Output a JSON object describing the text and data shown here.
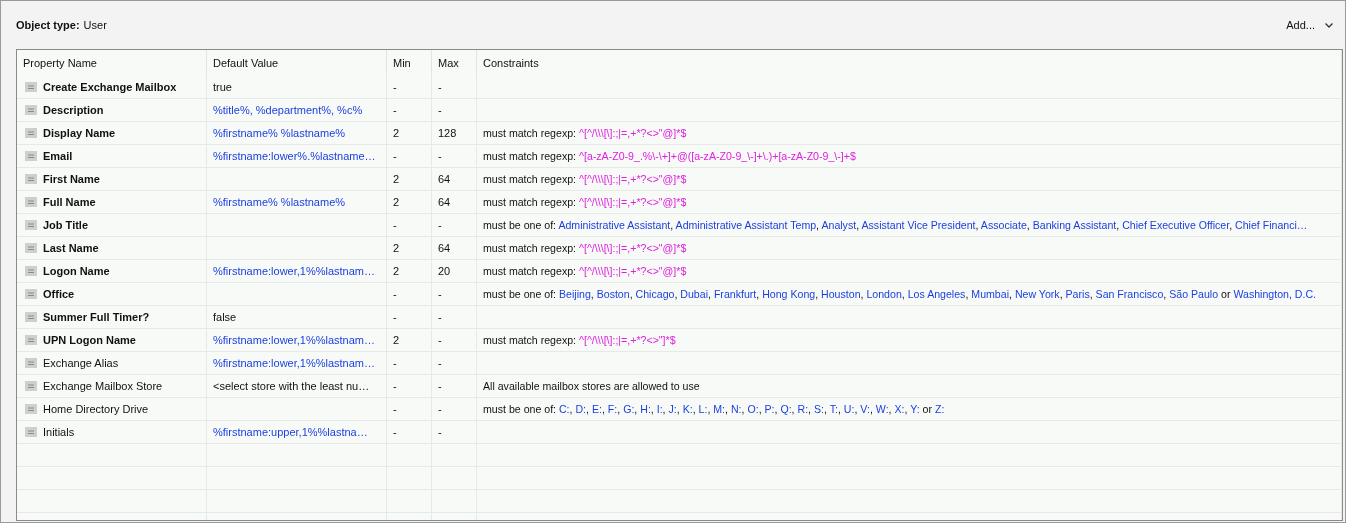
{
  "header": {
    "label": "Object type:",
    "value": "User",
    "add_button": "Add..."
  },
  "table": {
    "columns": [
      "Property Name",
      "Default Value",
      "Min",
      "Max",
      "Constraints"
    ],
    "rows": [
      {
        "name": "Create Exchange Mailbox",
        "required": true,
        "default": {
          "text": "true",
          "kind": "literal"
        },
        "min": "-",
        "max": "-"
      },
      {
        "name": "Description",
        "required": true,
        "default": {
          "text": "%title%, %department%, %c%",
          "kind": "template"
        },
        "min": "-",
        "max": "-"
      },
      {
        "name": "Display Name",
        "required": true,
        "default": {
          "text": "%firstname% %lastname%",
          "kind": "template"
        },
        "min": "2",
        "max": "128",
        "constraint": [
          {
            "text": "must match regexp: ",
            "kind": "label"
          },
          {
            "text": "^[^/\\\\\\[\\]:;|=,+*?<>\"@]*$",
            "kind": "regexp"
          }
        ]
      },
      {
        "name": "Email",
        "required": true,
        "default": {
          "text": "%firstname:lower%.%lastname…",
          "kind": "template"
        },
        "min": "-",
        "max": "-",
        "constraint": [
          {
            "text": "must match regexp: ",
            "kind": "label"
          },
          {
            "text": "^[a-zA-Z0-9_.%\\-\\+]+@([a-zA-Z0-9_\\-]+\\.)+[a-zA-Z0-9_\\-]+$",
            "kind": "regexp"
          }
        ]
      },
      {
        "name": "First Name",
        "required": true,
        "min": "2",
        "max": "64",
        "constraint": [
          {
            "text": "must match regexp: ",
            "kind": "label"
          },
          {
            "text": "^[^/\\\\\\[\\]:;|=,+*?<>\"@]*$",
            "kind": "regexp"
          }
        ]
      },
      {
        "name": "Full Name",
        "required": true,
        "default": {
          "text": "%firstname% %lastname%",
          "kind": "template"
        },
        "min": "2",
        "max": "64",
        "constraint": [
          {
            "text": "must match regexp: ",
            "kind": "label"
          },
          {
            "text": "^[^/\\\\\\[\\]:;|=,+*?<>\"@]*$",
            "kind": "regexp"
          }
        ]
      },
      {
        "name": "Job Title",
        "required": true,
        "min": "-",
        "max": "-",
        "constraint": [
          {
            "text": "must be one of: ",
            "kind": "label"
          },
          {
            "text": "Administrative Assistant",
            "kind": "value"
          },
          {
            "text": ", ",
            "kind": "label"
          },
          {
            "text": "Administrative Assistant Temp",
            "kind": "value"
          },
          {
            "text": ", ",
            "kind": "label"
          },
          {
            "text": "Analyst",
            "kind": "value"
          },
          {
            "text": ", ",
            "kind": "label"
          },
          {
            "text": "Assistant Vice President",
            "kind": "value"
          },
          {
            "text": ", ",
            "kind": "label"
          },
          {
            "text": "Associate",
            "kind": "value"
          },
          {
            "text": ", ",
            "kind": "label"
          },
          {
            "text": "Banking Assistant",
            "kind": "value"
          },
          {
            "text": ", ",
            "kind": "label"
          },
          {
            "text": "Chief Executive Officer",
            "kind": "value"
          },
          {
            "text": ", ",
            "kind": "label"
          },
          {
            "text": "Chief Financi…",
            "kind": "value"
          }
        ]
      },
      {
        "name": "Last Name",
        "required": true,
        "min": "2",
        "max": "64",
        "constraint": [
          {
            "text": "must match regexp: ",
            "kind": "label"
          },
          {
            "text": "^[^/\\\\\\[\\]:;|=,+*?<>\"@]*$",
            "kind": "regexp"
          }
        ]
      },
      {
        "name": "Logon Name",
        "required": true,
        "default": {
          "text": "%firstname:lower,1%%lastnam…",
          "kind": "template"
        },
        "min": "2",
        "max": "20",
        "constraint": [
          {
            "text": "must match regexp: ",
            "kind": "label"
          },
          {
            "text": "^[^/\\\\\\[\\]:;|=,+*?<>\"@]*$",
            "kind": "regexp"
          }
        ]
      },
      {
        "name": "Office",
        "required": true,
        "min": "-",
        "max": "-",
        "constraint": [
          {
            "text": "must be one of: ",
            "kind": "label"
          },
          {
            "text": "Beijing",
            "kind": "value"
          },
          {
            "text": ", ",
            "kind": "label"
          },
          {
            "text": "Boston",
            "kind": "value"
          },
          {
            "text": ", ",
            "kind": "label"
          },
          {
            "text": "Chicago",
            "kind": "value"
          },
          {
            "text": ", ",
            "kind": "label"
          },
          {
            "text": "Dubai",
            "kind": "value"
          },
          {
            "text": ", ",
            "kind": "label"
          },
          {
            "text": "Frankfurt",
            "kind": "value"
          },
          {
            "text": ", ",
            "kind": "label"
          },
          {
            "text": "Hong Kong",
            "kind": "value"
          },
          {
            "text": ", ",
            "kind": "label"
          },
          {
            "text": "Houston",
            "kind": "value"
          },
          {
            "text": ", ",
            "kind": "label"
          },
          {
            "text": "London",
            "kind": "value"
          },
          {
            "text": ", ",
            "kind": "label"
          },
          {
            "text": "Los Angeles",
            "kind": "value"
          },
          {
            "text": ", ",
            "kind": "label"
          },
          {
            "text": "Mumbai",
            "kind": "value"
          },
          {
            "text": ", ",
            "kind": "label"
          },
          {
            "text": "New York",
            "kind": "value"
          },
          {
            "text": ", ",
            "kind": "label"
          },
          {
            "text": "Paris",
            "kind": "value"
          },
          {
            "text": ", ",
            "kind": "label"
          },
          {
            "text": "San Francisco",
            "kind": "value"
          },
          {
            "text": ", ",
            "kind": "label"
          },
          {
            "text": "São Paulo",
            "kind": "value"
          },
          {
            "text": " or ",
            "kind": "label"
          },
          {
            "text": "Washington, D.C.",
            "kind": "value"
          }
        ]
      },
      {
        "name": "Summer Full Timer?",
        "required": true,
        "default": {
          "text": "false",
          "kind": "literal"
        },
        "min": "-",
        "max": "-"
      },
      {
        "name": "UPN Logon Name",
        "required": true,
        "default": {
          "text": "%firstname:lower,1%%lastnam…",
          "kind": "template"
        },
        "min": "2",
        "max": "-",
        "constraint": [
          {
            "text": "must match regexp: ",
            "kind": "label"
          },
          {
            "text": "^[^/\\\\\\[\\]:;|=,+*?<>\"]*$",
            "kind": "regexp"
          }
        ]
      },
      {
        "name": "Exchange Alias",
        "required": false,
        "default": {
          "text": "%firstname:lower,1%%lastnam…",
          "kind": "template"
        },
        "min": "-",
        "max": "-"
      },
      {
        "name": "Exchange Mailbox Store",
        "required": false,
        "default": {
          "text": "<select store with the least nu…",
          "kind": "literal"
        },
        "min": "-",
        "max": "-",
        "constraint": [
          {
            "text": "All available mailbox stores are allowed to use",
            "kind": "label"
          }
        ]
      },
      {
        "name": "Home Directory Drive",
        "required": false,
        "min": "-",
        "max": "-",
        "constraint": [
          {
            "text": "must be one of: ",
            "kind": "label"
          },
          {
            "text": "C:",
            "kind": "value"
          },
          {
            "text": ", ",
            "kind": "label"
          },
          {
            "text": "D:",
            "kind": "value"
          },
          {
            "text": ", ",
            "kind": "label"
          },
          {
            "text": "E:",
            "kind": "value"
          },
          {
            "text": ", ",
            "kind": "label"
          },
          {
            "text": "F:",
            "kind": "value"
          },
          {
            "text": ", ",
            "kind": "label"
          },
          {
            "text": "G:",
            "kind": "value"
          },
          {
            "text": ", ",
            "kind": "label"
          },
          {
            "text": "H:",
            "kind": "value"
          },
          {
            "text": ", ",
            "kind": "label"
          },
          {
            "text": "I:",
            "kind": "value"
          },
          {
            "text": ", ",
            "kind": "label"
          },
          {
            "text": "J:",
            "kind": "value"
          },
          {
            "text": ", ",
            "kind": "label"
          },
          {
            "text": "K:",
            "kind": "value"
          },
          {
            "text": ", ",
            "kind": "label"
          },
          {
            "text": "L:",
            "kind": "value"
          },
          {
            "text": ", ",
            "kind": "label"
          },
          {
            "text": "M:",
            "kind": "value"
          },
          {
            "text": ", ",
            "kind": "label"
          },
          {
            "text": "N:",
            "kind": "value"
          },
          {
            "text": ", ",
            "kind": "label"
          },
          {
            "text": "O:",
            "kind": "value"
          },
          {
            "text": ", ",
            "kind": "label"
          },
          {
            "text": "P:",
            "kind": "value"
          },
          {
            "text": ", ",
            "kind": "label"
          },
          {
            "text": "Q:",
            "kind": "value"
          },
          {
            "text": ", ",
            "kind": "label"
          },
          {
            "text": "R:",
            "kind": "value"
          },
          {
            "text": ", ",
            "kind": "label"
          },
          {
            "text": "S:",
            "kind": "value"
          },
          {
            "text": ", ",
            "kind": "label"
          },
          {
            "text": "T:",
            "kind": "value"
          },
          {
            "text": ", ",
            "kind": "label"
          },
          {
            "text": "U:",
            "kind": "value"
          },
          {
            "text": ", ",
            "kind": "label"
          },
          {
            "text": "V:",
            "kind": "value"
          },
          {
            "text": ", ",
            "kind": "label"
          },
          {
            "text": "W:",
            "kind": "value"
          },
          {
            "text": ", ",
            "kind": "label"
          },
          {
            "text": "X:",
            "kind": "value"
          },
          {
            "text": ", ",
            "kind": "label"
          },
          {
            "text": "Y:",
            "kind": "value"
          },
          {
            "text": " or ",
            "kind": "label"
          },
          {
            "text": "Z:",
            "kind": "value"
          }
        ]
      },
      {
        "name": "Initials",
        "required": false,
        "default": {
          "text": "%firstname:upper,1%%lastna…",
          "kind": "template"
        },
        "min": "-",
        "max": "-"
      }
    ]
  }
}
